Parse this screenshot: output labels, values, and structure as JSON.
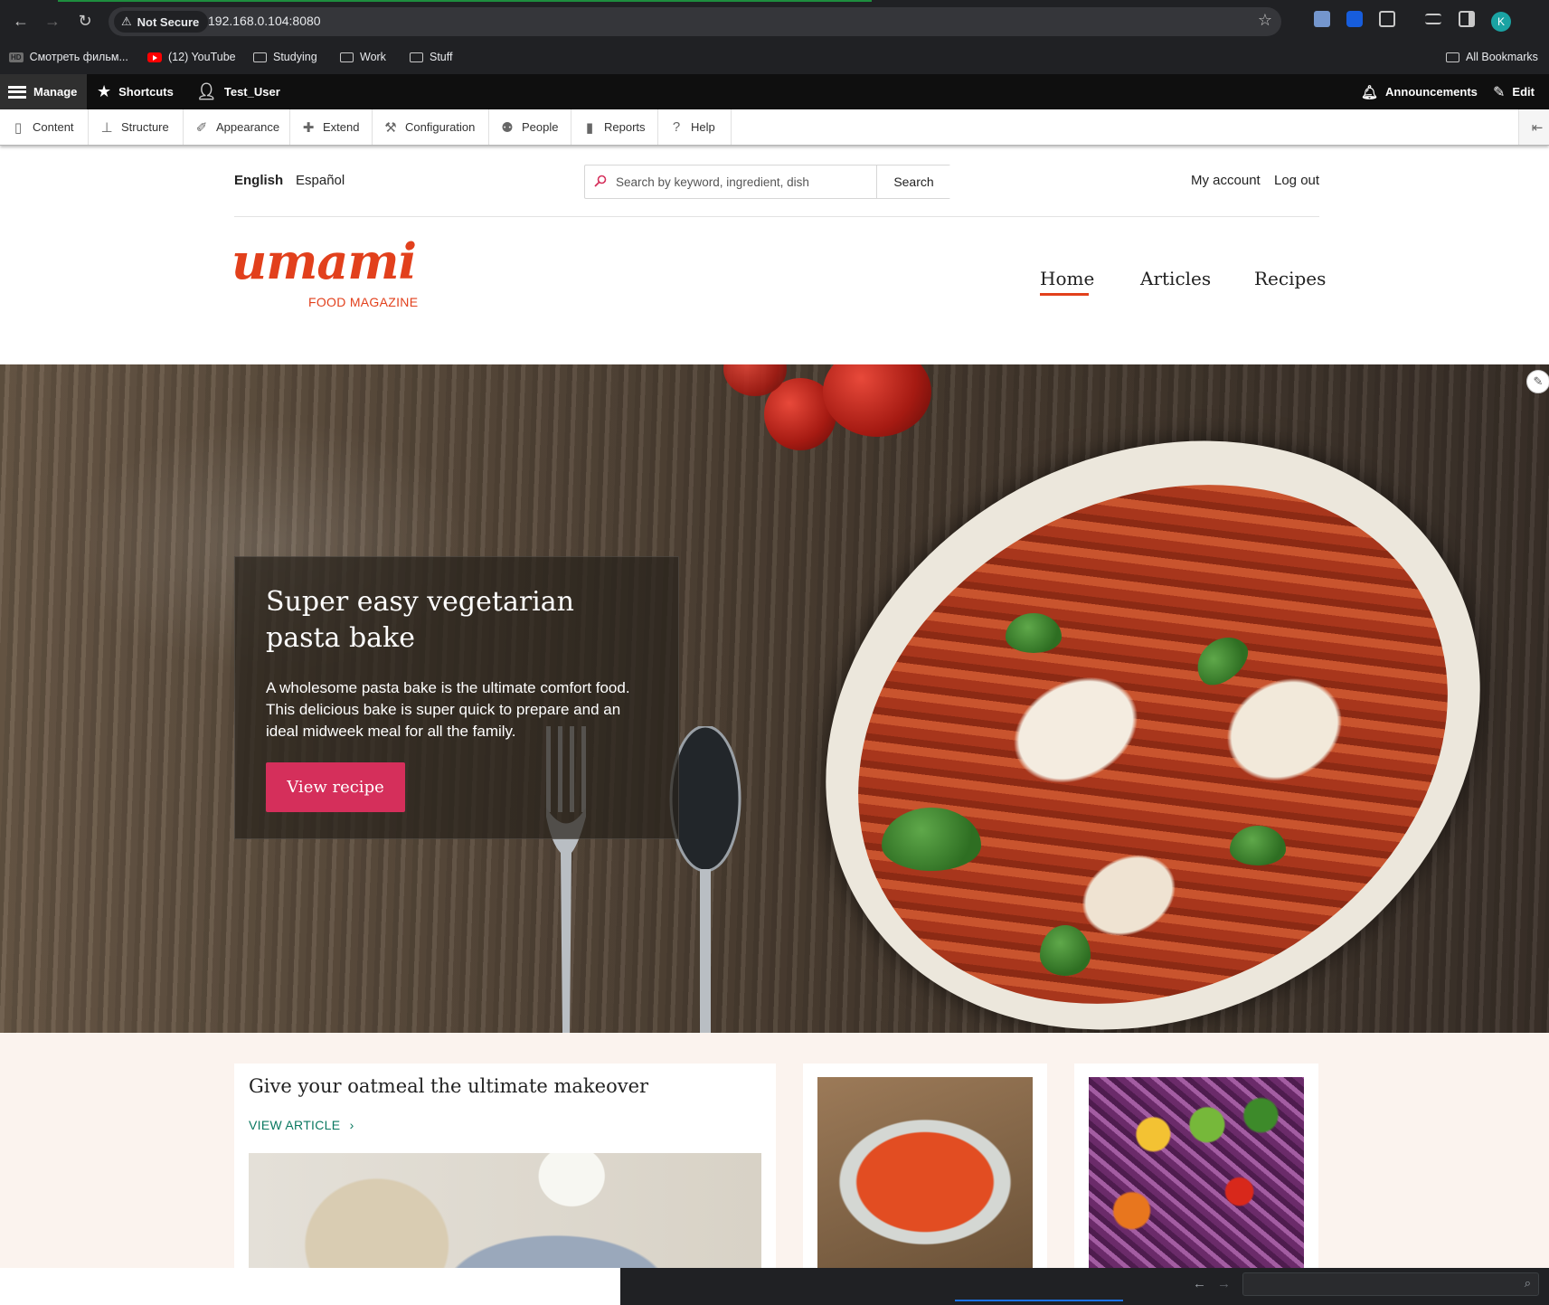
{
  "browser": {
    "security_label": "Not Secure",
    "url": "192.168.0.104:8080",
    "bookmarks": [
      {
        "label": "Смотреть фильм...",
        "icon": "hd-icon"
      },
      {
        "label": "(12) YouTube",
        "icon": "youtube-icon"
      },
      {
        "label": "Studying",
        "icon": "folder-icon"
      },
      {
        "label": "Work",
        "icon": "folder-icon"
      },
      {
        "label": "Stuff",
        "icon": "folder-icon"
      }
    ],
    "all_bookmarks": "All Bookmarks",
    "profile_initial": "K"
  },
  "admin_toolbar": {
    "manage": "Manage",
    "shortcuts": "Shortcuts",
    "user": "Test_User",
    "announcements": "Announcements",
    "edit": "Edit",
    "tray": [
      "Content",
      "Structure",
      "Appearance",
      "Extend",
      "Configuration",
      "People",
      "Reports",
      "Help"
    ]
  },
  "site": {
    "languages": [
      "English",
      "Español"
    ],
    "search": {
      "placeholder": "Search by keyword, ingredient, dish",
      "button": "Search"
    },
    "account_links": [
      "My account",
      "Log out"
    ],
    "logo": {
      "word": "umami",
      "subtitle": "FOOD MAGAZINE"
    },
    "nav": [
      "Home",
      "Articles",
      "Recipes"
    ],
    "active_nav": "Home",
    "accent_color": "#e2401c"
  },
  "hero": {
    "title": "Super easy vegetarian pasta bake",
    "description": "A wholesome pasta bake is the ultimate comfort food. This delicious bake is super quick to prepare and an ideal midweek meal for all the family.",
    "button": "View recipe",
    "button_color": "#d52f5b"
  },
  "cards": {
    "article": {
      "title": "Give your oatmeal the ultimate makeover",
      "link": "VIEW ARTICLE"
    }
  }
}
